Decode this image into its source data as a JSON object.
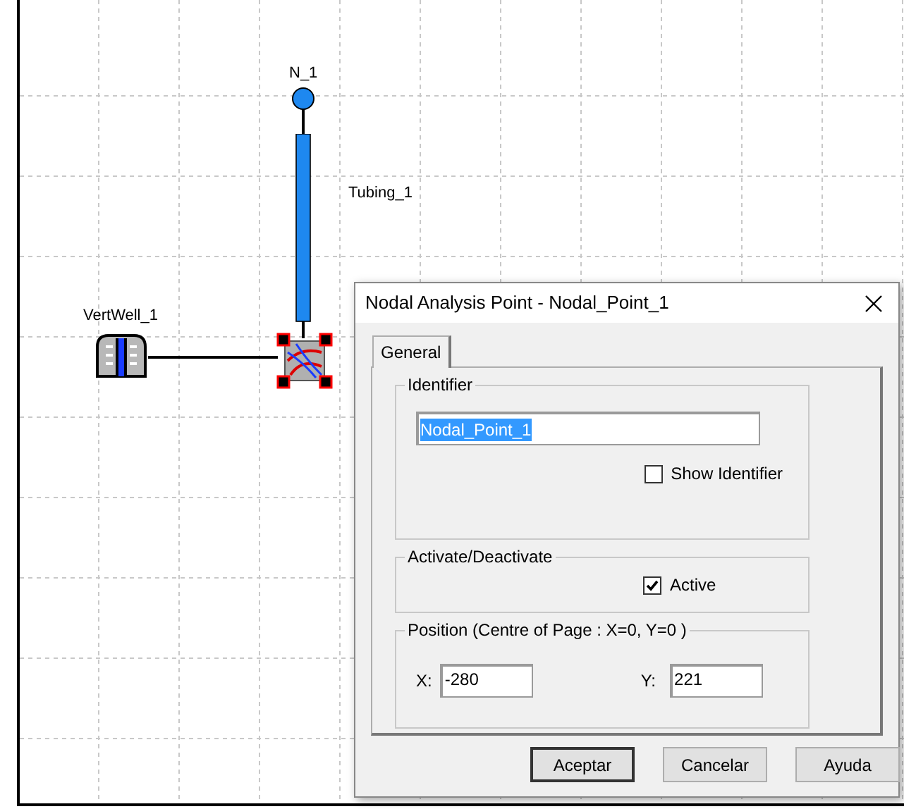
{
  "canvas": {
    "items": [
      {
        "kind": "node",
        "label": "N_1"
      },
      {
        "kind": "tubing",
        "label": "Tubing_1"
      },
      {
        "kind": "well",
        "label": "VertWell_1"
      },
      {
        "kind": "nodal_point",
        "selected": true
      }
    ]
  },
  "dialog": {
    "title": "Nodal Analysis Point - Nodal_Point_1",
    "tabs": [
      {
        "label": "General",
        "selected": true
      }
    ],
    "identifier": {
      "legend": "Identifier",
      "value": "Nodal_Point_1",
      "text_selected": true,
      "show_identifier": {
        "label": "Show Identifier",
        "checked": false
      }
    },
    "activation": {
      "legend": "Activate/Deactivate",
      "active": {
        "label": "Active",
        "checked": true
      }
    },
    "position": {
      "legend": "Position (Centre of Page : X=0, Y=0 )",
      "x_label": "X:",
      "x_value": "-280",
      "y_label": "Y:",
      "y_value": "221"
    },
    "buttons": [
      {
        "label": "Aceptar",
        "default": true
      },
      {
        "label": "Cancelar",
        "default": false
      },
      {
        "label": "Ayuda",
        "default": false
      }
    ]
  }
}
